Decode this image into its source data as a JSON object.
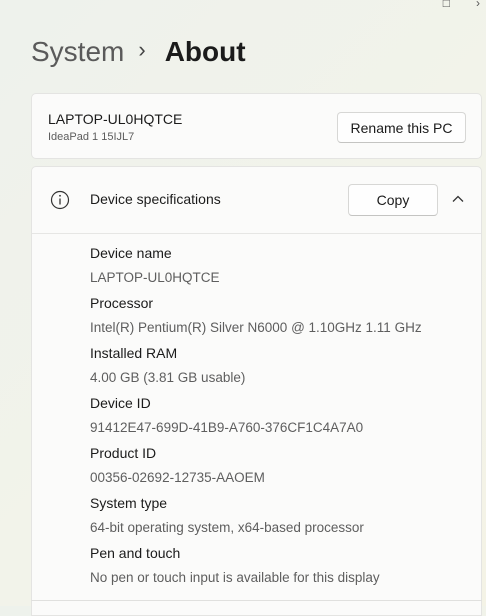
{
  "breadcrumb": {
    "parent": "System",
    "separator": "›",
    "current": "About"
  },
  "pc": {
    "name": "LAPTOP-UL0HQTCE",
    "model": "IdeaPad 1 15IJL7",
    "rename_label": "Rename this PC"
  },
  "specs": {
    "title": "Device specifications",
    "copy_label": "Copy",
    "items": [
      {
        "label": "Device name",
        "value": "LAPTOP-UL0HQTCE"
      },
      {
        "label": "Processor",
        "value": "Intel(R) Pentium(R) Silver N6000 @ 1.10GHz   1.11 GHz"
      },
      {
        "label": "Installed RAM",
        "value": "4.00 GB (3.81 GB usable)"
      },
      {
        "label": "Device ID",
        "value": "91412E47-699D-41B9-A760-376CF1C4A7A0"
      },
      {
        "label": "Product ID",
        "value": "00356-02692-12735-AAOEM"
      },
      {
        "label": "System type",
        "value": "64-bit operating system, x64-based processor"
      },
      {
        "label": "Pen and touch",
        "value": "No pen or touch input is available for this display"
      }
    ]
  }
}
